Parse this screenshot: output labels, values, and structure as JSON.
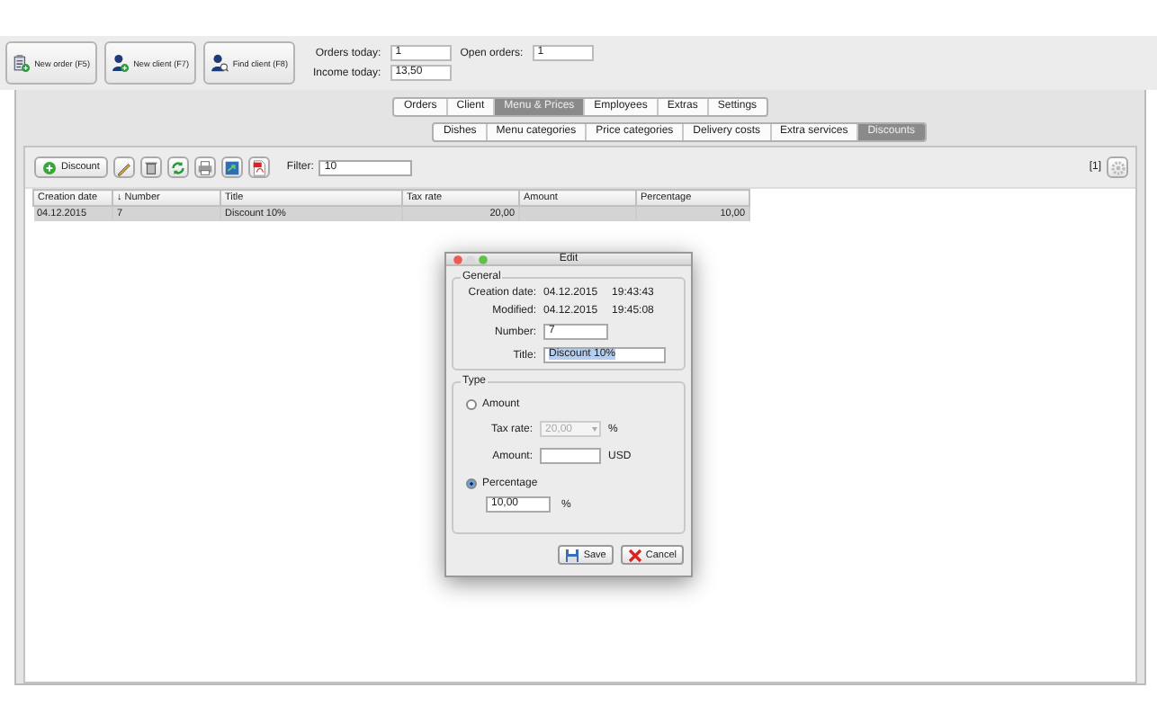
{
  "toolbar": [
    {
      "label": "New order (F5)"
    },
    {
      "label": "New client (F7)"
    },
    {
      "label": "Find client (F8)"
    }
  ],
  "stats": [
    {
      "label": "Orders today:",
      "value": "1"
    },
    {
      "label": "Open orders:",
      "value": "1"
    },
    {
      "label": "Income today:",
      "value": "13,50"
    }
  ],
  "tabs": [
    {
      "label": "Orders",
      "selected": false
    },
    {
      "label": "Client",
      "selected": false
    },
    {
      "label": "Menu & Prices",
      "selected": true
    },
    {
      "label": "Employees",
      "selected": false
    },
    {
      "label": "Extras",
      "selected": false
    },
    {
      "label": "Settings",
      "selected": false
    }
  ],
  "subtabs": [
    {
      "label": "Dishes",
      "selected": false
    },
    {
      "label": "Menu categories",
      "selected": false
    },
    {
      "label": "Price categories",
      "selected": false
    },
    {
      "label": "Delivery costs",
      "selected": false
    },
    {
      "label": "Extra services",
      "selected": false
    },
    {
      "label": "Discounts",
      "selected": true
    }
  ],
  "actions": {
    "add_button": "Discount",
    "filter_label": "Filter:",
    "filter_value": "10",
    "count": "[1]"
  },
  "table": {
    "columns": [
      "Creation date",
      "↓ Number",
      "Title",
      "Tax rate",
      "Amount",
      "Percentage"
    ],
    "rows": [
      {
        "cells": [
          "04.12.2015",
          "7",
          "Discount 10%",
          "20,00",
          "",
          "10,00"
        ],
        "selected": true
      }
    ]
  },
  "dialog": {
    "title": "Edit",
    "general": {
      "legend": "General",
      "creation_label": "Creation date:",
      "creation_date": "04.12.2015",
      "creation_time": "19:43:43",
      "modified_label": "Modified:",
      "modified_date": "04.12.2015",
      "modified_time": "19:45:08",
      "number_label": "Number:",
      "number": "7",
      "title_label": "Title:",
      "title": "Discount 10%",
      "title_highlighted": true
    },
    "type": {
      "legend": "Type",
      "options": [
        {
          "label": "Amount",
          "selected": false
        },
        {
          "label": "Percentage",
          "selected": true
        }
      ],
      "tax_label": "Tax rate:",
      "tax_value": "20,00",
      "tax_unit": "%",
      "tax_disabled": true,
      "amount_label": "Amount:",
      "amount_unit": "USD",
      "percentage": "10,00",
      "percentage_unit": "%"
    },
    "buttons": [
      "Save",
      "Cancel"
    ]
  }
}
